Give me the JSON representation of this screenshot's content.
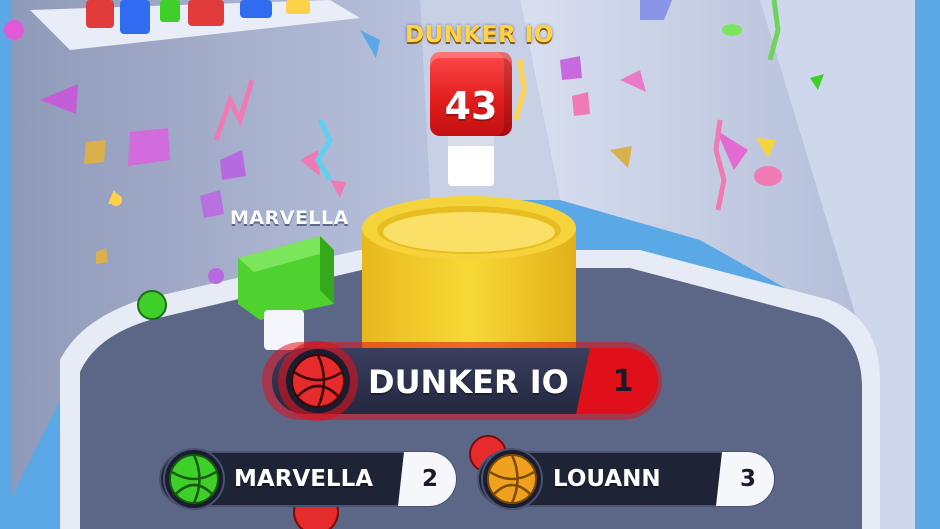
{
  "game": {
    "top_player_label": "DUNKER IO",
    "top_player_score": "43",
    "opponent_label": "MARVELLA"
  },
  "leaderboard": [
    {
      "name": "DUNKER IO",
      "rank": "1",
      "ball_color": "#e52b2b"
    },
    {
      "name": "MARVELLA",
      "rank": "2",
      "ball_color": "#3fcf2a"
    },
    {
      "name": "LOUANN",
      "rank": "3",
      "ball_color": "#f0a21e"
    }
  ],
  "colors": {
    "sky": "#5aa9e6",
    "tower_wall": "#b9c4dc",
    "platform": "#5c6787",
    "hoop": "#f2cf2e",
    "score_cube": "#e01c1c",
    "player_cube": "#4fd12f",
    "leader_highlight": "#e0101a"
  }
}
